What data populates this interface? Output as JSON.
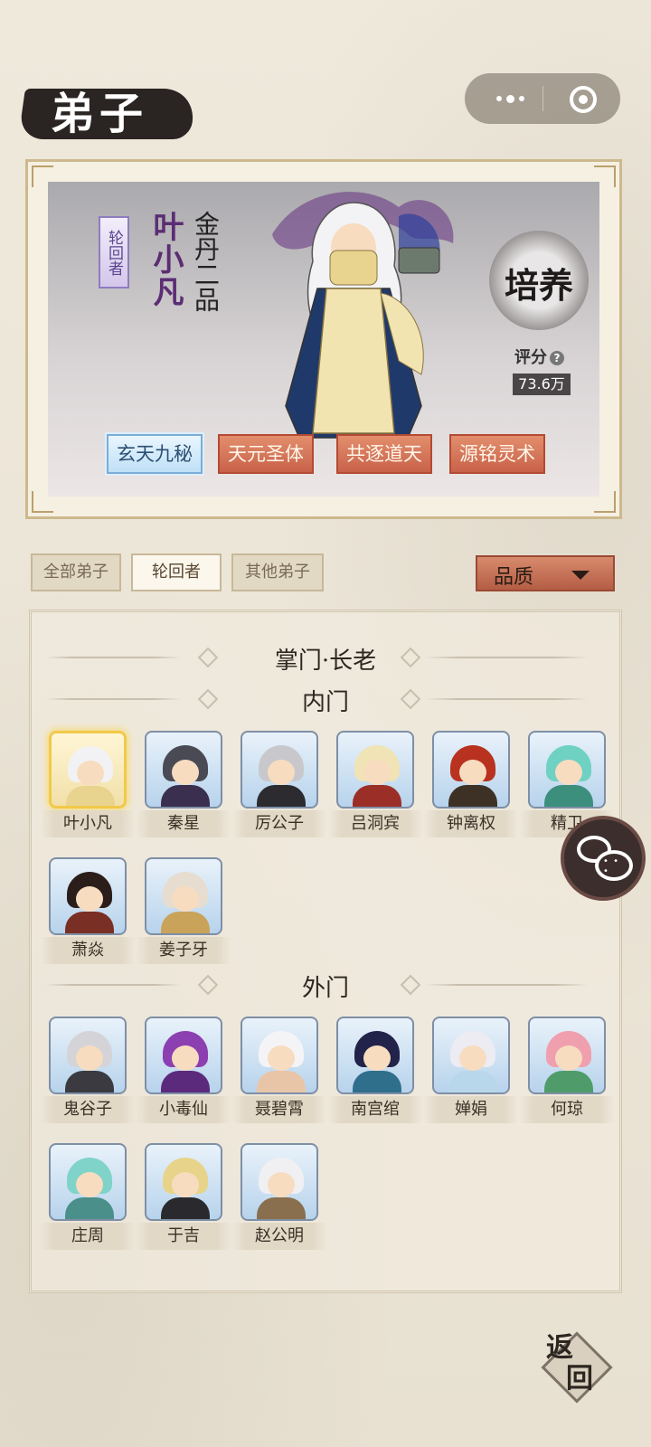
{
  "header": {
    "title": "弟子"
  },
  "hero": {
    "rank_tag": "轮回者",
    "name": "叶小凡",
    "realm": "金丹二品",
    "train_label": "培养",
    "score_label": "评分",
    "score_help": "?",
    "score_value": "73.6万",
    "skills": [
      "玄天九秘",
      "天元圣体",
      "共逐道天",
      "源铭灵术"
    ]
  },
  "filters": {
    "tabs": [
      "全部弟子",
      "轮回者",
      "其他弟子"
    ],
    "active_tab": "轮回者",
    "quality_label": "品质"
  },
  "sections": {
    "leaders": "掌门·长老",
    "inner": "内门",
    "outer": "外门"
  },
  "inner_disciples": [
    "叶小凡",
    "秦星",
    "厉公子",
    "吕洞宾",
    "钟离权",
    "精卫",
    "萧焱",
    "姜子牙"
  ],
  "outer_disciples": [
    "鬼谷子",
    "小毒仙",
    "聂碧霄",
    "南宫绾",
    "婵娟",
    "何琼",
    "庄周",
    "于吉",
    "赵公明"
  ],
  "back_button": "返回",
  "colors": {
    "accent_red": "#c8624a",
    "selected_gold": "#f1c94a",
    "skill_blue": "#7aaed8"
  }
}
